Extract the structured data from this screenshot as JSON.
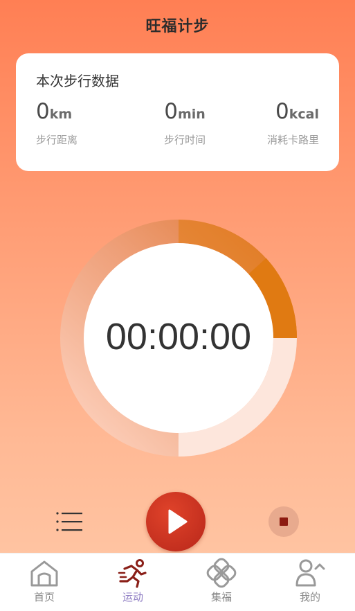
{
  "header": {
    "title": "旺福计步"
  },
  "stats_card": {
    "title": "本次步行数据",
    "distance": {
      "value": "0",
      "unit": "km",
      "label": "步行距离"
    },
    "time": {
      "value": "0",
      "unit": "min",
      "label": "步行时间"
    },
    "calories": {
      "value": "0",
      "unit": "kcal",
      "label": "消耗卡路里"
    }
  },
  "timer": {
    "display": "00:00:00"
  },
  "controls": {
    "list_icon": "list-icon",
    "play_icon": "play-icon",
    "stop_icon": "stop-icon"
  },
  "tabs": [
    {
      "label": "首页",
      "icon": "home-icon",
      "active": false
    },
    {
      "label": "运动",
      "icon": "running-icon",
      "active": true
    },
    {
      "label": "集福",
      "icon": "clover-icon",
      "active": false
    },
    {
      "label": "我的",
      "icon": "profile-icon",
      "active": false
    }
  ],
  "colors": {
    "accent": "#e07a12",
    "play": "#c8301f",
    "tab_active": "#8e7cc3"
  }
}
